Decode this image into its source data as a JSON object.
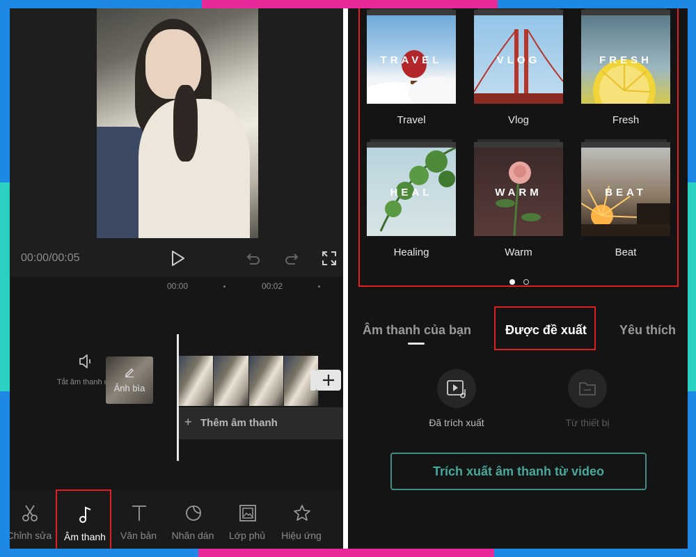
{
  "left": {
    "time": "00:00/00:05",
    "ticks": [
      "00:00",
      "00:02"
    ],
    "mute_label": "Tắt âm thanh clip",
    "cover_label": "Ảnh bìa",
    "add_audio_label": "Thêm âm thanh",
    "toolbar": [
      {
        "label": "Chỉnh sửa",
        "icon": "scissors-icon"
      },
      {
        "label": "Âm thanh",
        "icon": "music-note-icon",
        "active": true
      },
      {
        "label": "Văn bản",
        "icon": "text-icon"
      },
      {
        "label": "Nhãn dán",
        "icon": "sticker-icon"
      },
      {
        "label": "Lớp phủ",
        "icon": "overlay-icon"
      },
      {
        "label": "Hiệu ứng",
        "icon": "effects-icon"
      }
    ]
  },
  "right": {
    "templates": [
      {
        "word": "TRAVEL",
        "name": "Travel"
      },
      {
        "word": "VLOG",
        "name": "Vlog"
      },
      {
        "word": "FRESH",
        "name": "Fresh"
      },
      {
        "word": "HEAL",
        "name": "Healing"
      },
      {
        "word": "WARM",
        "name": "Warm"
      },
      {
        "word": "BEAT",
        "name": "Beat"
      }
    ],
    "tabs": [
      "Âm thanh của bạn",
      "Được đề xuất",
      "Yêu thích"
    ],
    "extracted_label": "Đã trích xuất",
    "device_label": "Từ thiết bị",
    "extract_button": "Trích xuất âm thanh từ video"
  },
  "colors": {
    "accent": "#48a89c",
    "highlight": "#e02020"
  }
}
